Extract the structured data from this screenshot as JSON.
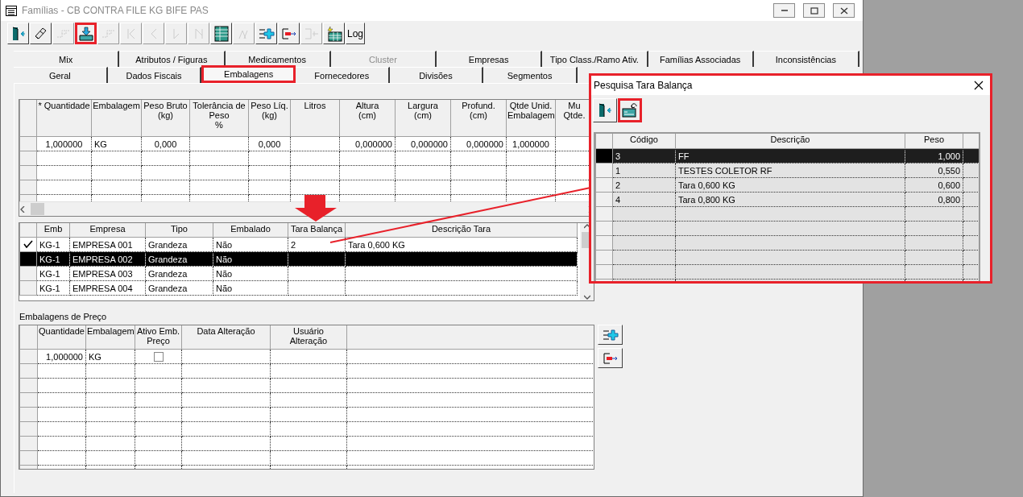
{
  "window": {
    "title": "Famílias - CB CONTRA FILE KG BIFE PAS"
  },
  "toolbar": [
    {
      "kind": "exit",
      "disabled": false,
      "highlighted": false
    },
    {
      "kind": "eraser",
      "disabled": false,
      "highlighted": false
    },
    {
      "kind": "tree",
      "disabled": true,
      "highlighted": false
    },
    {
      "kind": "import",
      "disabled": false,
      "highlighted": true
    },
    {
      "kind": "tree",
      "disabled": true,
      "highlighted": false
    },
    {
      "kind": "first",
      "disabled": true,
      "highlighted": false
    },
    {
      "kind": "prev",
      "disabled": true,
      "highlighted": false
    },
    {
      "kind": "next",
      "disabled": true,
      "highlighted": false
    },
    {
      "kind": "last",
      "disabled": true,
      "highlighted": false
    },
    {
      "kind": "grid",
      "disabled": false,
      "highlighted": false
    },
    {
      "kind": "branch",
      "disabled": true,
      "highlighted": false
    },
    {
      "kind": "add",
      "disabled": false,
      "highlighted": false
    },
    {
      "kind": "remove",
      "disabled": false,
      "highlighted": false
    },
    {
      "kind": "split",
      "disabled": true,
      "highlighted": false
    },
    {
      "kind": "grid_lightning",
      "disabled": false,
      "highlighted": false
    },
    {
      "kind": "text",
      "label": "Log",
      "disabled": false,
      "highlighted": false
    }
  ],
  "tabs_row_1": [
    {
      "label": "Mix",
      "selected": false,
      "disabled": false,
      "highlighted": false
    },
    {
      "label": "Atributos / Figuras",
      "selected": false,
      "disabled": false,
      "highlighted": false
    },
    {
      "label": "Medicamentos",
      "selected": false,
      "disabled": false,
      "highlighted": false
    },
    {
      "label": "Cluster",
      "selected": false,
      "disabled": true,
      "highlighted": false
    },
    {
      "label": "Empresas",
      "selected": false,
      "disabled": false,
      "highlighted": false
    },
    {
      "label": "Tipo Class./Ramo Ativ.",
      "selected": false,
      "disabled": false,
      "highlighted": false
    },
    {
      "label": "Famílias Associadas",
      "selected": false,
      "disabled": false,
      "highlighted": false
    },
    {
      "label": "Inconsistências",
      "selected": false,
      "disabled": false,
      "highlighted": false
    }
  ],
  "tabs_row_2": [
    {
      "label": "Geral",
      "selected": false,
      "disabled": false,
      "highlighted": false
    },
    {
      "label": "Dados Fiscais",
      "selected": false,
      "disabled": false,
      "highlighted": false
    },
    {
      "label": "Embalagens",
      "selected": true,
      "disabled": false,
      "highlighted": true
    },
    {
      "label": "Fornecedores",
      "selected": false,
      "disabled": false,
      "highlighted": false
    },
    {
      "label": "Divisões",
      "selected": false,
      "disabled": false,
      "highlighted": false
    },
    {
      "label": "Segmentos",
      "selected": false,
      "disabled": false,
      "highlighted": false
    }
  ],
  "packaging_table": {
    "columns": [
      "* Quantidade",
      "Embalagem",
      "Peso Bruto\n(kg)",
      "Tolerância de\nPeso\n%",
      "Peso Líq.\n(kg)",
      "Litros",
      "Altura\n(cm)",
      "Largura\n(cm)",
      "Profund.\n(cm)",
      "Qtde Unid.\nEmbalagem",
      "Mu\nQtde."
    ],
    "rows": [
      {
        "cells": [
          "1,000000",
          "KG",
          "0,000",
          null,
          "0,000",
          null,
          "0,000000",
          "0,000000",
          "0,000000",
          "1,000000",
          null
        ]
      }
    ]
  },
  "company_table": {
    "columns": [
      "Emb",
      "Empresa",
      "Tipo",
      "Embalado",
      "Tara Balança",
      "Descrição Tara"
    ],
    "rows": [
      {
        "current": true,
        "selected": false,
        "cells": [
          "KG-1",
          "EMPRESA 001",
          "Grandeza",
          "Não",
          "2",
          "Tara 0,600 KG"
        ]
      },
      {
        "current": false,
        "selected": true,
        "cells": [
          "KG-1",
          "EMPRESA 002",
          "Grandeza",
          "Não",
          null,
          null
        ]
      },
      {
        "current": false,
        "selected": false,
        "cells": [
          "KG-1",
          "EMPRESA 003",
          "Grandeza",
          "Não",
          null,
          null
        ]
      },
      {
        "current": false,
        "selected": false,
        "cells": [
          "KG-1",
          "EMPRESA 004",
          "Grandeza",
          "Não",
          null,
          null
        ]
      }
    ]
  },
  "price_section": {
    "title": "Embalagens de Preço",
    "columns": [
      "Quantidade",
      "Embalagem",
      "Ativo Emb.\nPreço",
      "Data Alteração",
      "Usuário\nAlteração"
    ],
    "rows": [
      {
        "quantity": "1,000000",
        "packaging": "KG",
        "active": false
      }
    ],
    "buttons": [
      {
        "kind": "add"
      },
      {
        "kind": "remove"
      }
    ]
  },
  "dialog": {
    "title": "Pesquisa Tara Balança",
    "highlighted": true,
    "toolbar": [
      {
        "kind": "exit",
        "highlighted": false
      },
      {
        "kind": "return",
        "highlighted": true
      }
    ],
    "columns": [
      "Código",
      "Descrição",
      "Peso"
    ],
    "rows": [
      {
        "selected": true,
        "cells": [
          "3",
          "FF",
          "1,000"
        ]
      },
      {
        "selected": false,
        "cells": [
          "1",
          "TESTES COLETOR RF",
          "0,550"
        ]
      },
      {
        "selected": false,
        "cells": [
          "2",
          "Tara 0,600 KG",
          "0,600"
        ]
      },
      {
        "selected": false,
        "cells": [
          "4",
          "Tara 0,800 KG",
          "0,800"
        ]
      }
    ]
  }
}
